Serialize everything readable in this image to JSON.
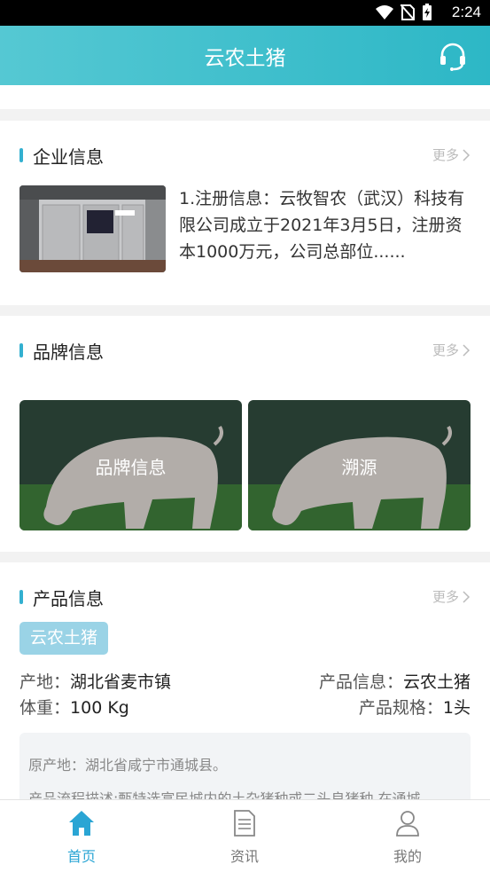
{
  "status_bar": {
    "time": "2:24"
  },
  "header": {
    "title": "云农土猪",
    "service_icon": "headset-icon"
  },
  "enterprise": {
    "title": "企业信息",
    "more": "更多",
    "summary": "1.注册信息：云牧智农（武汉）科技有限公司成立于2021年3月5日，注册资本1000万元，公司总部位......"
  },
  "brand": {
    "title": "品牌信息",
    "more": "更多",
    "tiles": [
      {
        "label": "品牌信息"
      },
      {
        "label": "溯源"
      }
    ]
  },
  "product": {
    "title": "产品信息",
    "more": "更多",
    "tag": "云农土猪",
    "origin_label": "产地：",
    "origin_value": "湖北省麦市镇",
    "info_label": "产品信息：",
    "info_value": "云农土猪",
    "weight_label": "体重：",
    "weight_value": "100 Kg",
    "spec_label": "产品规格：",
    "spec_value": "1头",
    "desc_line1": "原产地：湖北省咸宁市通城县。",
    "desc_line2": "产品流程描述:甄特选富民城内的土杂猪种或二头良猪种,在通城"
  },
  "tabbar": {
    "items": [
      {
        "label": "首页",
        "icon": "home-icon",
        "active": true
      },
      {
        "label": "资讯",
        "icon": "news-icon",
        "active": false
      },
      {
        "label": "我的",
        "icon": "user-icon",
        "active": false
      }
    ]
  },
  "colors": {
    "accent": "#2db7c6",
    "tab_active": "#2aa5d4",
    "section_bar": "#33b0d0",
    "tag_bg": "#9ad3e6"
  }
}
